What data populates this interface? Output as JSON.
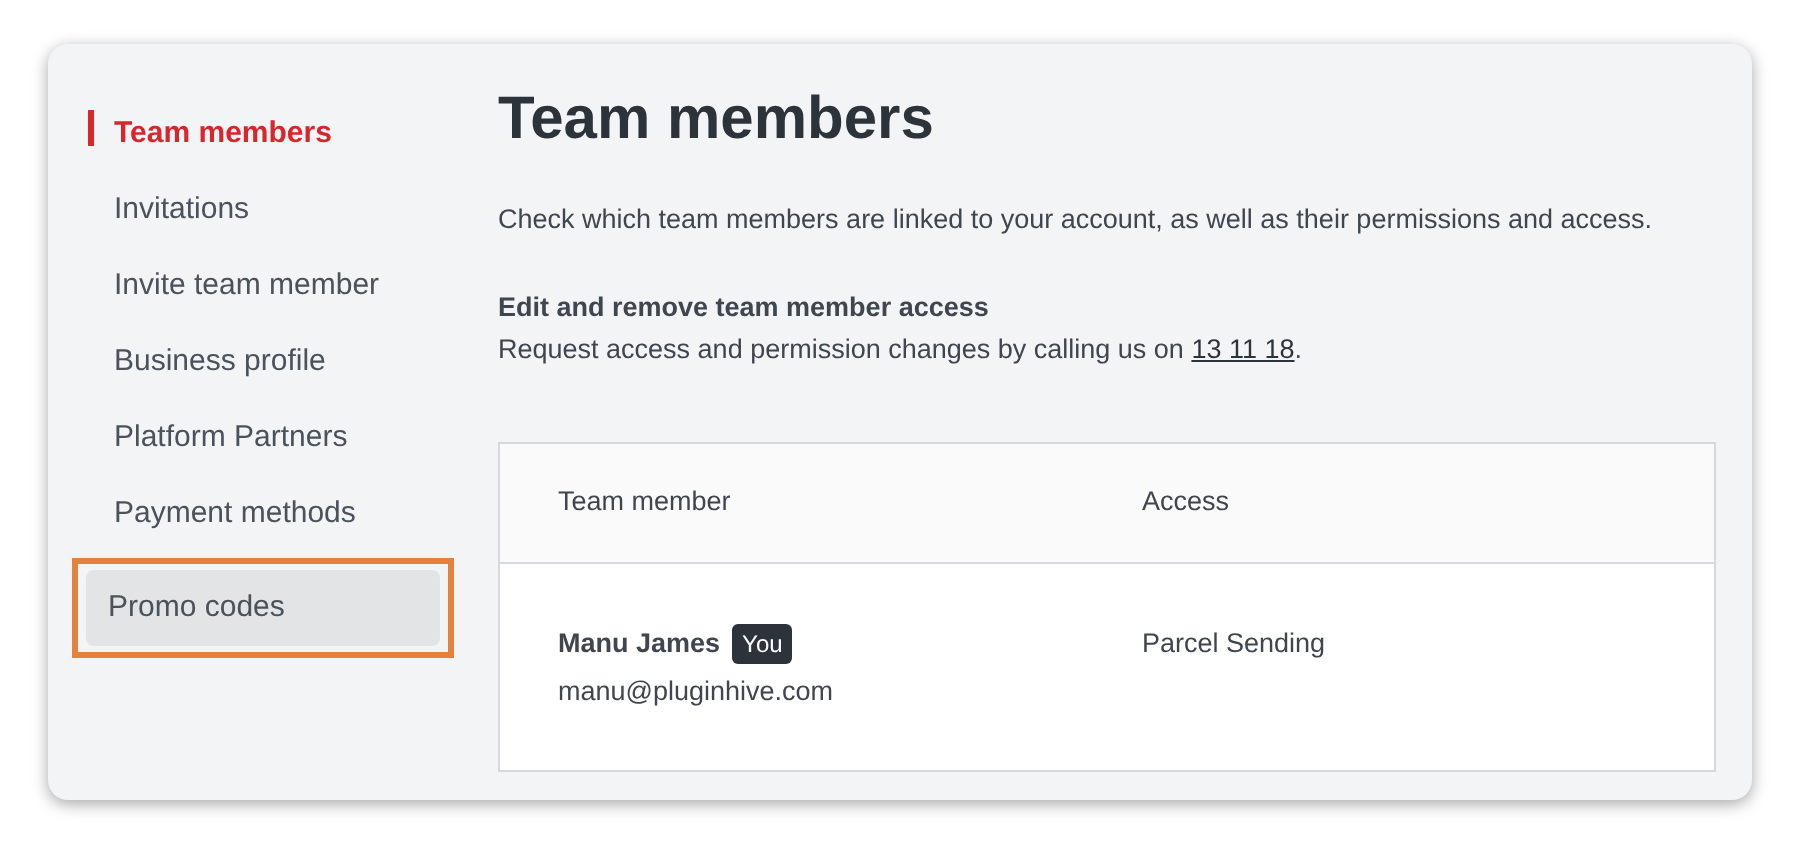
{
  "sidebar": {
    "items": [
      {
        "label": "Team members",
        "selected": true,
        "highlighted": false
      },
      {
        "label": "Invitations",
        "selected": false,
        "highlighted": false
      },
      {
        "label": "Invite team member",
        "selected": false,
        "highlighted": false
      },
      {
        "label": "Business profile",
        "selected": false,
        "highlighted": false
      },
      {
        "label": "Platform Partners",
        "selected": false,
        "highlighted": false
      },
      {
        "label": "Payment methods",
        "selected": false,
        "highlighted": false
      },
      {
        "label": "Promo codes",
        "selected": false,
        "highlighted": true
      }
    ]
  },
  "title": "Team members",
  "intro": "Check which team members are linked to your account, as well as their permissions and access.",
  "section_heading": "Edit and remove team member access",
  "request": {
    "text": "Request access and permission changes by calling us on ",
    "link": "13 11 18",
    "suffix": "."
  },
  "table": {
    "columns": [
      "Team member",
      "Access"
    ],
    "rows": [
      {
        "name": "Manu James",
        "badge": "You",
        "email": "manu@pluginhive.com",
        "access": "Parcel Sending"
      }
    ]
  }
}
